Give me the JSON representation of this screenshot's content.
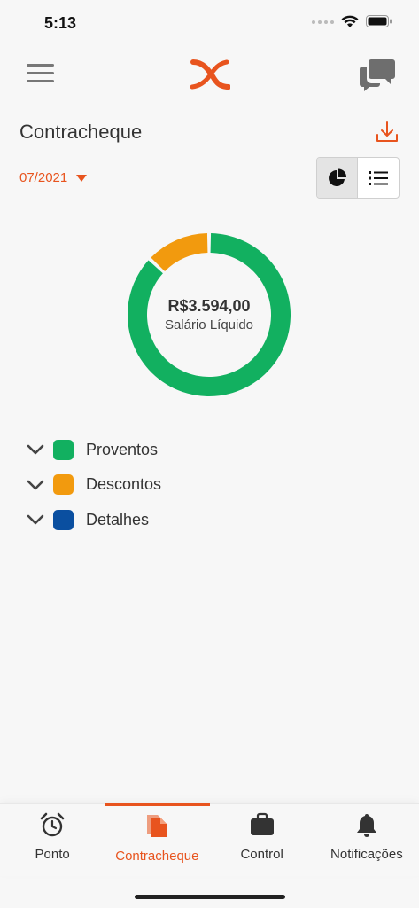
{
  "status_bar": {
    "time": "5:13"
  },
  "header": {
    "menu_icon": "hamburger-menu-icon",
    "logo_icon": "brand-logo",
    "chat_icon": "chat-bubbles-icon"
  },
  "page": {
    "title": "Contracheque",
    "download_icon": "download-icon",
    "period": "07/2021",
    "view_modes": [
      "pie-chart-icon",
      "list-icon"
    ],
    "active_view": "pie-chart-icon"
  },
  "chart_data": {
    "type": "pie",
    "center_value": "R$3.594,00",
    "center_label": "Salário Líquido",
    "categories": [
      "Proventos",
      "Descontos",
      "Detalhes"
    ],
    "values": [
      87,
      13,
      0
    ],
    "colors": [
      "#12b060",
      "#f29a0e",
      "#0a4fa0"
    ]
  },
  "legend": [
    {
      "label": "Proventos",
      "color": "#12b060"
    },
    {
      "label": "Descontos",
      "color": "#f29a0e"
    },
    {
      "label": "Detalhes",
      "color": "#0a4fa0"
    }
  ],
  "bottom_nav": [
    {
      "label": "Ponto",
      "icon": "alarm-clock-icon",
      "active": false
    },
    {
      "label": "Contracheque",
      "icon": "document-icon",
      "active": true
    },
    {
      "label": "Control",
      "icon": "briefcase-icon",
      "active": false
    },
    {
      "label": "Notificações",
      "icon": "bell-icon",
      "active": false
    }
  ],
  "colors": {
    "accent": "#e8541e",
    "background": "#f7f7f7"
  }
}
